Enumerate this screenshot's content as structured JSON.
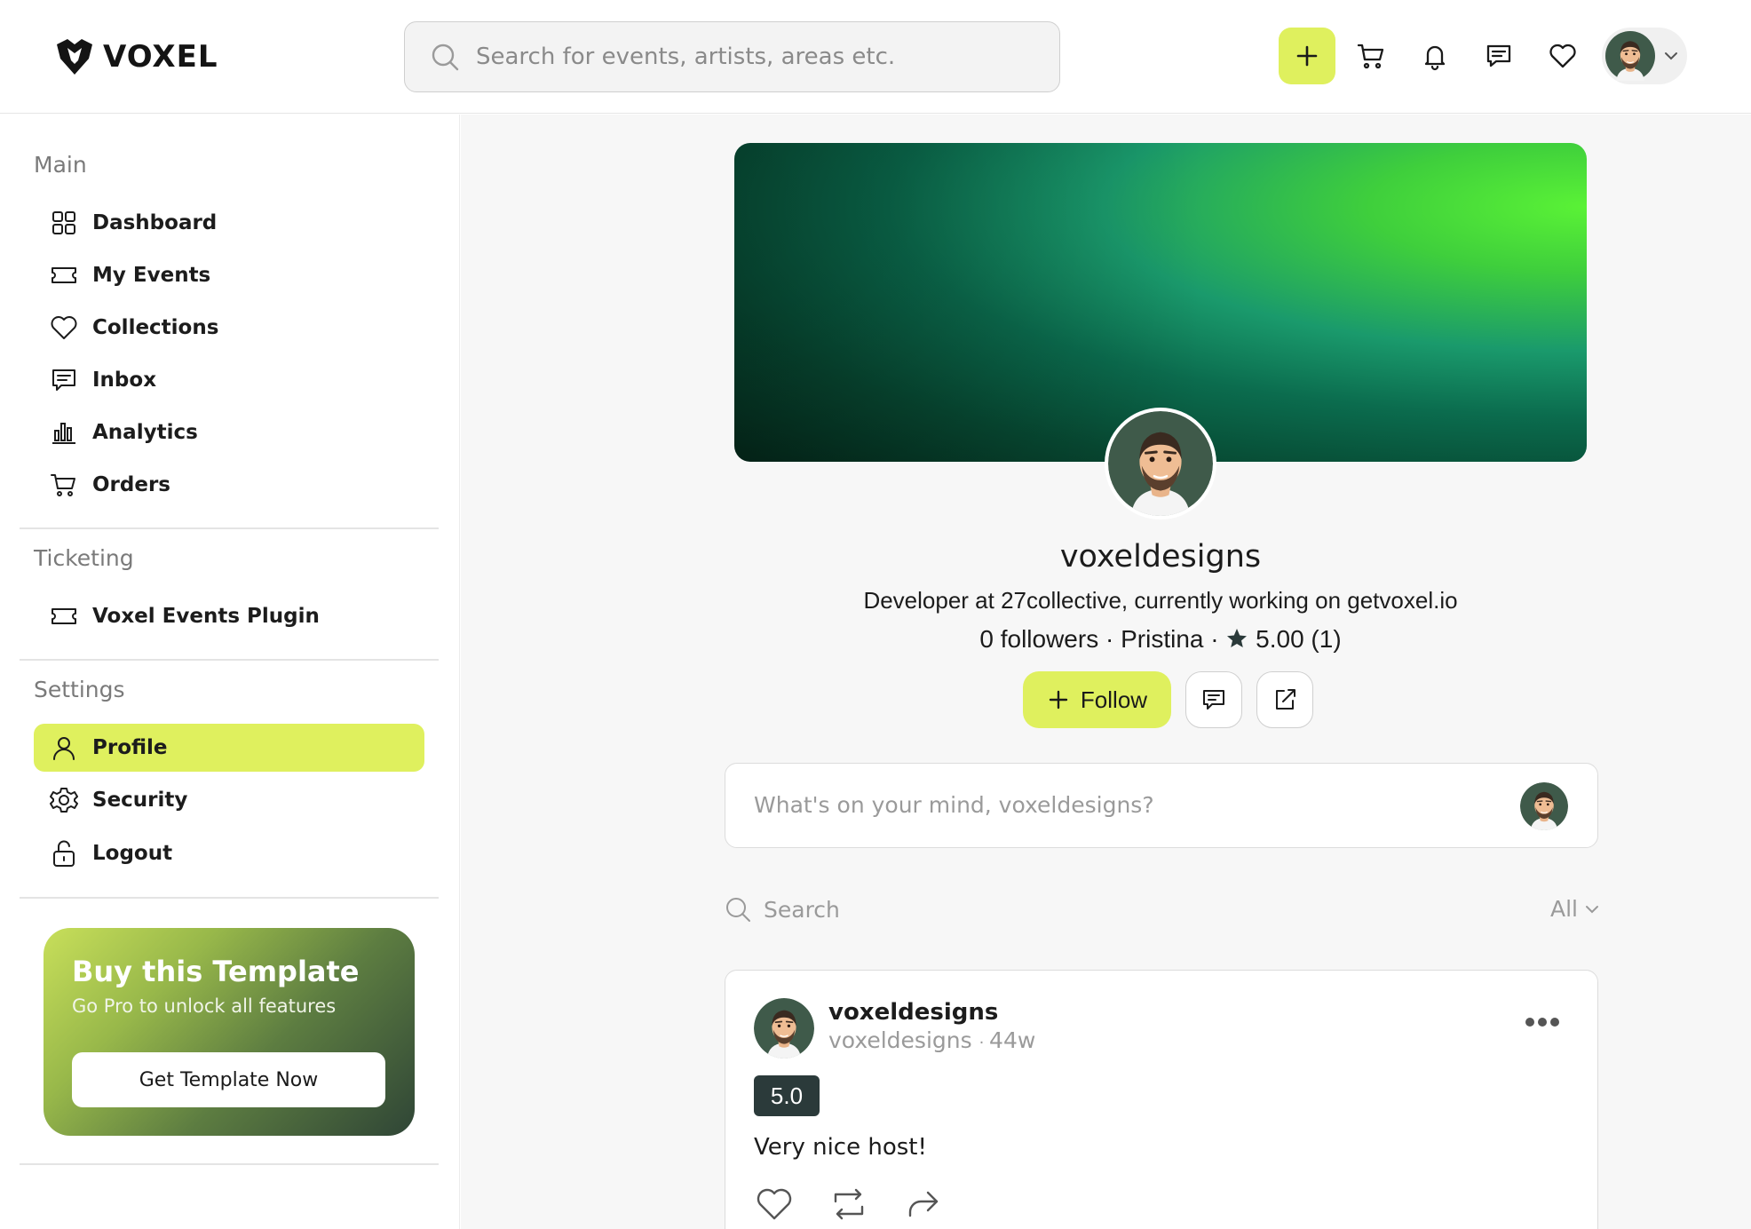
{
  "brand": {
    "name": "VOXEL"
  },
  "header": {
    "search_placeholder": "Search for events, artists, areas etc.",
    "icons": [
      "plus-icon",
      "cart-icon",
      "bell-icon",
      "chat-icon",
      "heart-icon",
      "avatar",
      "chevron-down-icon"
    ]
  },
  "sidebar": {
    "sections": {
      "main": "Main",
      "ticketing": "Ticketing",
      "settings": "Settings"
    },
    "main_items": [
      {
        "label": "Dashboard",
        "icon": "grid-icon"
      },
      {
        "label": "My Events",
        "icon": "ticket-icon"
      },
      {
        "label": "Collections",
        "icon": "heart-icon"
      },
      {
        "label": "Inbox",
        "icon": "chat-icon"
      },
      {
        "label": "Analytics",
        "icon": "bar-chart-icon"
      },
      {
        "label": "Orders",
        "icon": "cart-icon"
      }
    ],
    "ticketing_items": [
      {
        "label": "Voxel Events Plugin",
        "icon": "ticket-icon"
      }
    ],
    "settings_items": [
      {
        "label": "Profile",
        "icon": "user-icon",
        "active": true
      },
      {
        "label": "Security",
        "icon": "gear-icon"
      },
      {
        "label": "Logout",
        "icon": "unlock-icon"
      }
    ],
    "promo": {
      "title": "Buy this Template",
      "subtitle": "Go Pro to unlock all features",
      "button": "Get Template Now"
    }
  },
  "profile": {
    "name": "voxeldesigns",
    "bio": "Developer at 27collective, currently working on getvoxel.io",
    "followers": "0 followers",
    "location": "Pristina",
    "rating": "5.00 (1)",
    "follow_label": "Follow"
  },
  "composer": {
    "placeholder": "What's on your mind, voxeldesigns?"
  },
  "feed": {
    "search_placeholder": "Search",
    "filter": "All"
  },
  "post": {
    "author": "voxeldesigns",
    "handle": "voxeldesigns",
    "time": "44w",
    "rating": "5.0",
    "text": "Very nice host!"
  },
  "colors": {
    "accent": "#dff05e",
    "badge": "#2b3a3a",
    "text": "#1c1c1c",
    "muted": "#9a9a9a"
  }
}
